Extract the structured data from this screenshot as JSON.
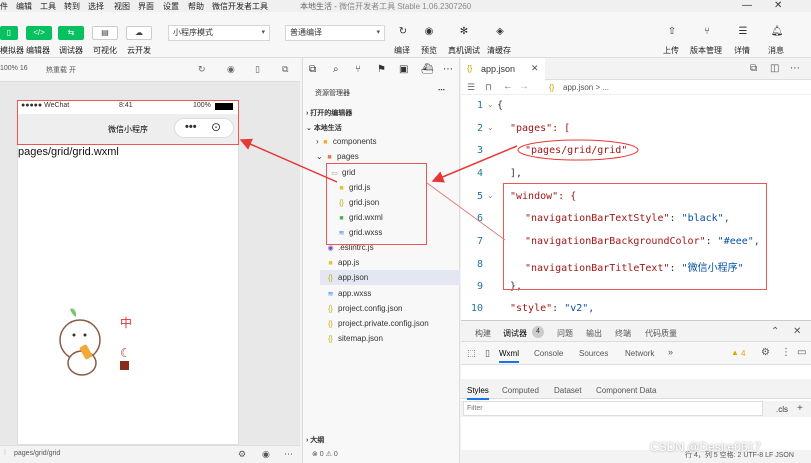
{
  "menu": {
    "items": [
      "件",
      "编辑",
      "工具",
      "转到",
      "选择",
      "视图",
      "界面",
      "设置",
      "帮助",
      "微信开发者工具"
    ],
    "window_title": "本地生活",
    "app_version": "微信开发者工具 Stable 1.06.2307260"
  },
  "toolbar": {
    "left_labels": [
      "模拟器",
      "编辑器",
      "调试器",
      "可视化",
      "云开发"
    ],
    "mode_select": "小程序模式",
    "compile_select": "普通编译",
    "mid_labels": [
      "编译",
      "预览",
      "真机调试",
      "清缓存"
    ],
    "right_labels": [
      "上传",
      "版本管理",
      "详情",
      "消息"
    ]
  },
  "simulator": {
    "zoom": "100% 16",
    "hot_reload": "热重载 开",
    "status_carrier": "●●●●● WeChat",
    "status_time": "8:41",
    "status_battery": "100%",
    "nav_title": "微信小程序",
    "page_text": "pages/grid/grid.wxml",
    "footer_path": "pages/grid/grid"
  },
  "explorer": {
    "header": "资源管理器",
    "open_editors": "打开的编辑器",
    "project": "本地生活",
    "items": [
      {
        "name": "components",
        "type": "folder"
      },
      {
        "name": "pages",
        "type": "folder"
      },
      {
        "name": "grid",
        "type": "folder"
      },
      {
        "name": "grid.js",
        "type": "js"
      },
      {
        "name": "grid.json",
        "type": "json"
      },
      {
        "name": "grid.wxml",
        "type": "wxml"
      },
      {
        "name": "grid.wxss",
        "type": "wxss"
      },
      {
        "name": ".eslintrc.js",
        "type": "eslint"
      },
      {
        "name": "app.js",
        "type": "js"
      },
      {
        "name": "app.json",
        "type": "json"
      },
      {
        "name": "app.wxss",
        "type": "wxss"
      },
      {
        "name": "project.config.json",
        "type": "json"
      },
      {
        "name": "project.private.config.json",
        "type": "json"
      },
      {
        "name": "sitemap.json",
        "type": "json"
      }
    ],
    "outline": "大纲",
    "status": "⊗ 0 ⚠ 0"
  },
  "editor": {
    "tab": "app.json",
    "breadcrumb": "app.json > ...",
    "lines": [
      {
        "n": "1",
        "code": "{"
      },
      {
        "n": "2",
        "code": "\"pages\": ["
      },
      {
        "n": "3",
        "code": "\"pages/grid/grid\""
      },
      {
        "n": "4",
        "code": "],"
      },
      {
        "n": "5",
        "code": "\"window\": {"
      },
      {
        "n": "6",
        "key": "\"navigationBarTextStyle\"",
        "val": "\"black\","
      },
      {
        "n": "7",
        "key": "\"navigationBarBackgroundColor\"",
        "val": "\"#eee\","
      },
      {
        "n": "8",
        "key": "\"navigationBarTitleText\"",
        "val": "\"微信小程序\""
      },
      {
        "n": "9",
        "code": "},"
      },
      {
        "n": "10",
        "key": "\"style\"",
        "val": "\"v2\","
      }
    ]
  },
  "devtools": {
    "top_tabs": [
      "构建",
      "调试器",
      "问题",
      "输出",
      "终端",
      "代码质量"
    ],
    "badge": "4",
    "panel_tabs": [
      "Wxml",
      "Console",
      "Sources",
      "Network"
    ],
    "warn_count": "4",
    "sub_tabs": [
      "Styles",
      "Computed",
      "Dataset",
      "Component Data"
    ],
    "filter_placeholder": "Filter",
    "cls": ".cls",
    "status_right": "行 4，列 5   空格: 2   UTF-8   LF   JSON"
  },
  "watermark": "CSDN @Desire0617"
}
